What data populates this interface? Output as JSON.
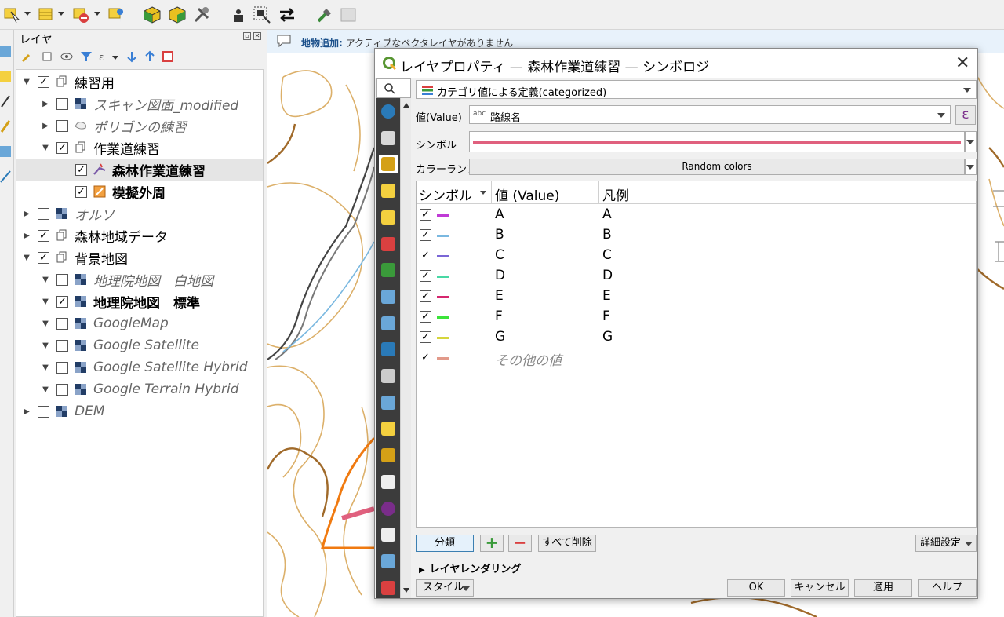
{
  "toolbar": {
    "icons": [
      "select-features-icon",
      "attribute-table-icon",
      "delete-selected-icon",
      "pan-to-selection-icon",
      "3d-box-icon",
      "3d-box-alt-icon",
      "tools-icon",
      "vertex-tool-icon",
      "select-by-area-icon",
      "swap-icon",
      "plugin-tool-icon",
      "disabled-tool-icon"
    ]
  },
  "layers_panel": {
    "title": "レイヤ",
    "tree": [
      {
        "label": "練習用",
        "level": 0,
        "expanded": true,
        "checked": true,
        "type": "group",
        "style": "normal"
      },
      {
        "label": "スキャン図面_modified",
        "level": 1,
        "expanded": false,
        "checked": false,
        "type": "raster",
        "style": "italic"
      },
      {
        "label": "ポリゴンの練習",
        "level": 1,
        "expanded": false,
        "checked": false,
        "type": "polygon",
        "style": "italic"
      },
      {
        "label": "作業道練習",
        "level": 1,
        "expanded": true,
        "checked": true,
        "type": "group",
        "style": "normal"
      },
      {
        "label": "森林作業道練習",
        "level": 2,
        "expanded": null,
        "checked": true,
        "type": "line",
        "style": "bold-underline",
        "selected": true
      },
      {
        "label": "模擬外周",
        "level": 2,
        "expanded": null,
        "checked": true,
        "type": "edit",
        "style": "bold"
      },
      {
        "label": "オルソ",
        "level": 0,
        "expanded": false,
        "checked": false,
        "type": "raster",
        "style": "italic"
      },
      {
        "label": "森林地域データ",
        "level": 0,
        "expanded": false,
        "checked": true,
        "type": "group",
        "style": "normal"
      },
      {
        "label": "背景地図",
        "level": 0,
        "expanded": true,
        "checked": true,
        "type": "group",
        "style": "normal"
      },
      {
        "label": "地理院地図　白地図",
        "level": 1,
        "expanded": true,
        "checked": false,
        "type": "raster",
        "style": "italic"
      },
      {
        "label": "地理院地図　標準",
        "level": 1,
        "expanded": true,
        "checked": true,
        "type": "raster",
        "style": "bold"
      },
      {
        "label": "GoogleMap",
        "level": 1,
        "expanded": true,
        "checked": false,
        "type": "raster",
        "style": "italic"
      },
      {
        "label": "Google Satellite",
        "level": 1,
        "expanded": true,
        "checked": false,
        "type": "raster",
        "style": "italic"
      },
      {
        "label": "Google Satellite Hybrid",
        "level": 1,
        "expanded": true,
        "checked": false,
        "type": "raster",
        "style": "italic"
      },
      {
        "label": "Google Terrain Hybrid",
        "level": 1,
        "expanded": true,
        "checked": false,
        "type": "raster",
        "style": "italic"
      },
      {
        "label": "DEM",
        "level": 0,
        "expanded": false,
        "checked": false,
        "type": "raster",
        "style": "italic"
      }
    ]
  },
  "message_bar": {
    "title": "地物追加:",
    "text": "アクティブなベクタレイヤがありません"
  },
  "dialog": {
    "title": "レイヤプロパティ — 森林作業道練習 — シンボロジ",
    "close": "✕",
    "renderer": "カテゴリ値による定義(categorized)",
    "value_label": "値(Value)",
    "value_type": "abc",
    "value_field": "路線名",
    "epsilon": "ε",
    "symbol_label": "シンボル",
    "symbol_color": "#e0607e",
    "colorramp_label": "カラーランプ",
    "colorramp_value": "Random colors",
    "table": {
      "headers": [
        "シンボル",
        "値 (Value)",
        "凡例"
      ],
      "rows": [
        {
          "checked": true,
          "color": "#c03ad6",
          "value": "A",
          "legend": "A"
        },
        {
          "checked": true,
          "color": "#7ab8e0",
          "value": "B",
          "legend": "B"
        },
        {
          "checked": true,
          "color": "#7a66d6",
          "value": "C",
          "legend": "C"
        },
        {
          "checked": true,
          "color": "#48d8a4",
          "value": "D",
          "legend": "D"
        },
        {
          "checked": true,
          "color": "#d6266e",
          "value": "E",
          "legend": "E"
        },
        {
          "checked": true,
          "color": "#3ce43a",
          "value": "F",
          "legend": "F"
        },
        {
          "checked": true,
          "color": "#d6d63c",
          "value": "G",
          "legend": "G"
        },
        {
          "checked": true,
          "color": "#e29a8a",
          "value": "その他の値",
          "legend": ""
        }
      ]
    },
    "buttons": {
      "classify": "分類",
      "add": "+",
      "remove": "−",
      "delete_all": "すべて削除",
      "advanced": "詳細設定",
      "layer_rendering": "レイヤレンダリング",
      "style": "スタイル",
      "ok": "OK",
      "cancel": "キャンセル",
      "apply": "適用",
      "help": "ヘルプ"
    },
    "side_icons": [
      "information-icon",
      "source-icon",
      "symbology-icon",
      "labels-icon",
      "masks-icon",
      "3d-view-icon",
      "diagrams-icon",
      "fields-icon",
      "attributes-form-icon",
      "joins-icon",
      "auxiliary-storage-icon",
      "actions-icon",
      "display-icon",
      "rendering-icon",
      "temporal-icon",
      "variables-icon",
      "metadata-icon",
      "dependencies-icon",
      "legend-icon"
    ]
  }
}
